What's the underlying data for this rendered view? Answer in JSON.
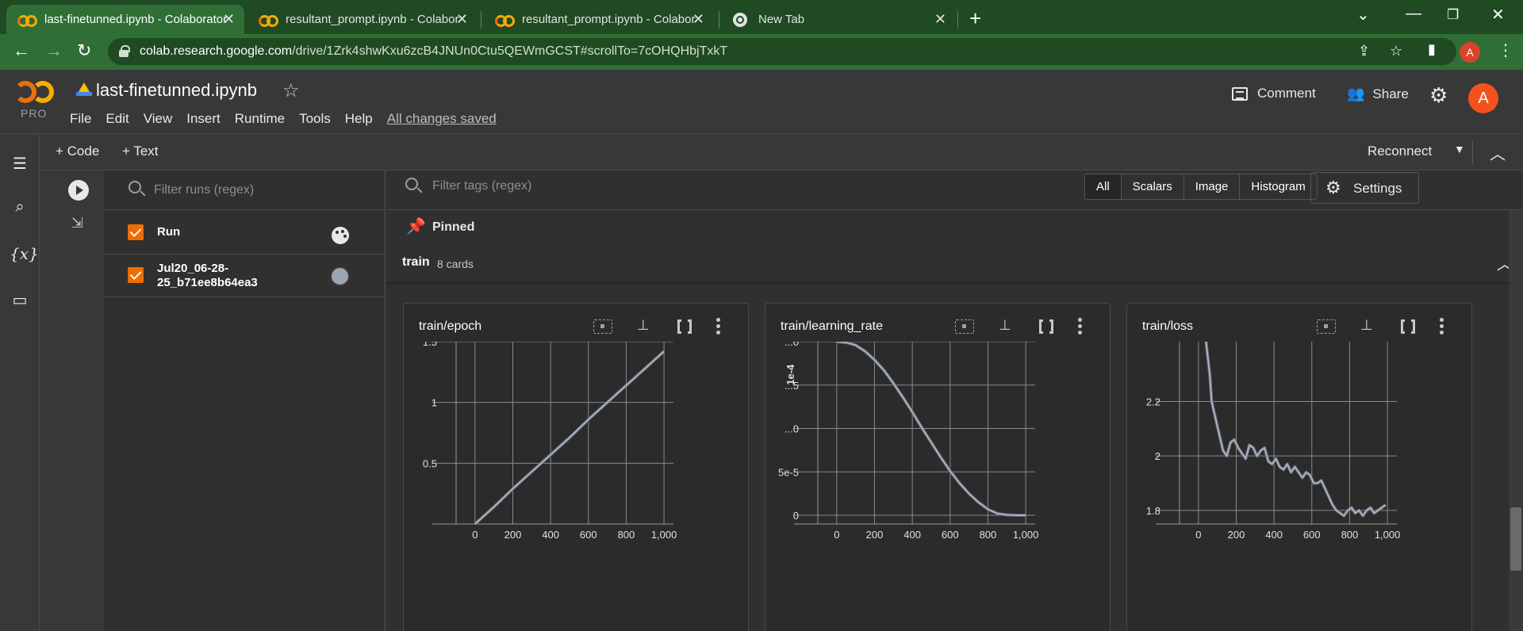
{
  "browser": {
    "tabs": [
      {
        "title": "last-finetunned.ipynb - Colaboratory",
        "icon": "colab-icon",
        "active": true
      },
      {
        "title": "resultant_prompt.ipynb - Colaboratory",
        "icon": "colab-icon",
        "active": false
      },
      {
        "title": "resultant_prompt.ipynb - Colaboratory",
        "icon": "colab-icon",
        "active": false
      },
      {
        "title": "New Tab",
        "icon": "chrome-icon",
        "active": false
      }
    ],
    "url_host": "colab.research.google.com",
    "url_path": "/drive/1Zrk4shwKxu6zcB4JNUn0Ctu5QEWmGCST#scrollTo=7cOHQHbjTxkT",
    "profile_initial": "A"
  },
  "colab": {
    "pro_label": "PRO",
    "notebook_title": "last-finetunned.ipynb",
    "menu": [
      "File",
      "Edit",
      "View",
      "Insert",
      "Runtime",
      "Tools",
      "Help"
    ],
    "save_status": "All changes saved",
    "comment_label": "Comment",
    "share_label": "Share",
    "user_initial": "A",
    "toolbar": {
      "add_code": "+ Code",
      "add_text": "+ Text",
      "reconnect": "Reconnect"
    }
  },
  "tensorboard": {
    "runs_filter_placeholder": "Filter runs (regex)",
    "runs": [
      {
        "label": "Run",
        "checked": true
      },
      {
        "label": "Jul20_06-28-25_b71ee8b64ea3",
        "label_line1": "Jul20_06-28-",
        "label_line2": "25_b71ee8b64ea3",
        "checked": true,
        "color": "#9aa5b1"
      }
    ],
    "tags_filter_placeholder": "Filter tags (regex)",
    "type_filters": [
      "All",
      "Scalars",
      "Image",
      "Histogram"
    ],
    "selected_type": "All",
    "settings_label": "Settings",
    "pinned_label": "Pinned",
    "group": {
      "name": "train",
      "count_label": "8 cards"
    }
  },
  "chart_data": [
    {
      "type": "line",
      "title": "train/epoch",
      "xlim": [
        -100,
        1050
      ],
      "ylim": [
        0,
        1.5
      ],
      "x_ticks": [
        "0",
        "200",
        "400",
        "600",
        "800",
        "1,000"
      ],
      "x_tick_values": [
        0,
        200,
        400,
        600,
        800,
        1000
      ],
      "y_ticks": [
        "0.5",
        "1",
        "1.5"
      ],
      "y_tick_values": [
        0.5,
        1,
        1.5
      ],
      "series": [
        {
          "x": [
            0,
            100,
            200,
            300,
            400,
            500,
            600,
            700,
            800,
            900,
            1000
          ],
          "y": [
            0,
            0.14,
            0.29,
            0.43,
            0.57,
            0.71,
            0.86,
            1.0,
            1.14,
            1.28,
            1.42
          ]
        }
      ]
    },
    {
      "type": "line",
      "title": "train/learning_rate",
      "xlim": [
        -100,
        1050
      ],
      "ylim": [
        -1e-05,
        0.0002
      ],
      "x_ticks": [
        "0",
        "200",
        "400",
        "600",
        "800",
        "1,000"
      ],
      "x_tick_values": [
        0,
        200,
        400,
        600,
        800,
        1000
      ],
      "y_ticks": [
        "0",
        "5e-5",
        "...0",
        "...5",
        "...0"
      ],
      "y_tick_values": [
        0,
        5e-05,
        0.0001,
        0.00015,
        0.0002
      ],
      "y_unit_label": "1e-4",
      "series": [
        {
          "x": [
            0,
            50,
            100,
            150,
            200,
            250,
            300,
            350,
            400,
            450,
            500,
            550,
            600,
            650,
            700,
            750,
            800,
            850,
            900,
            950,
            1000
          ],
          "y": [
            0.0002,
            0.000199,
            0.000196,
            0.000189,
            0.000179,
            0.000167,
            0.000152,
            0.000136,
            0.000119,
            0.000101,
            8.4e-05,
            6.7e-05,
            5.1e-05,
            3.7e-05,
            2.5e-05,
            1.5e-05,
            7e-06,
            2e-06,
            5e-07,
            1e-07,
            0
          ]
        }
      ]
    },
    {
      "type": "line",
      "title": "train/loss",
      "xlim": [
        -100,
        1050
      ],
      "ylim": [
        1.75,
        2.42
      ],
      "x_ticks": [
        "0",
        "200",
        "400",
        "600",
        "800",
        "1,000"
      ],
      "x_tick_values": [
        0,
        200,
        400,
        600,
        800,
        1000
      ],
      "y_ticks": [
        "1.8",
        "2",
        "2.2"
      ],
      "y_tick_values": [
        1.8,
        2.0,
        2.2
      ],
      "series": [
        {
          "x": [
            40,
            60,
            70,
            90,
            110,
            130,
            150,
            170,
            190,
            210,
            230,
            250,
            270,
            290,
            310,
            330,
            350,
            370,
            390,
            410,
            430,
            450,
            470,
            490,
            510,
            530,
            550,
            570,
            590,
            610,
            630,
            650,
            670,
            690,
            710,
            730,
            750,
            770,
            790,
            810,
            830,
            850,
            870,
            890,
            910,
            930,
            950,
            970,
            990
          ],
          "y": [
            2.42,
            2.3,
            2.2,
            2.14,
            2.08,
            2.02,
            2.0,
            2.05,
            2.06,
            2.03,
            2.01,
            1.99,
            2.04,
            2.03,
            2.0,
            2.02,
            2.03,
            1.98,
            1.97,
            1.99,
            1.96,
            1.95,
            1.97,
            1.94,
            1.96,
            1.94,
            1.92,
            1.94,
            1.93,
            1.9,
            1.9,
            1.91,
            1.88,
            1.85,
            1.82,
            1.8,
            1.79,
            1.78,
            1.8,
            1.81,
            1.79,
            1.8,
            1.78,
            1.8,
            1.81,
            1.79,
            1.8,
            1.81,
            1.82
          ]
        }
      ]
    }
  ]
}
